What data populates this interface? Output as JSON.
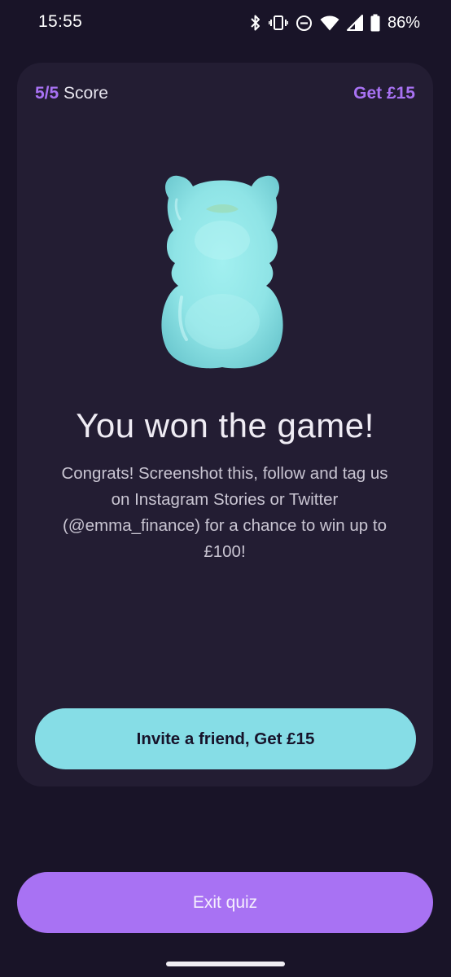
{
  "status_bar": {
    "time": "15:55",
    "battery_percent": "86%",
    "icons": [
      "bluetooth-icon",
      "vibrate-icon",
      "do-not-disturb-icon",
      "wifi-icon",
      "cellular-signal-icon",
      "battery-icon"
    ]
  },
  "card": {
    "score_value": "5/5",
    "score_label": "Score",
    "reward_link": "Get £15",
    "illustration": "gummy-bear",
    "title": "You won the game!",
    "message": "Congrats! Screenshot this, follow and tag us on Instagram Stories or Twitter (@emma_finance) for a chance to win up to £100!",
    "invite_button": "Invite a friend, Get £15"
  },
  "footer": {
    "exit_button": "Exit quiz"
  },
  "colors": {
    "background": "#191428",
    "card": "#231d33",
    "accent_purple": "#a872f3",
    "accent_teal": "#86dde6"
  }
}
